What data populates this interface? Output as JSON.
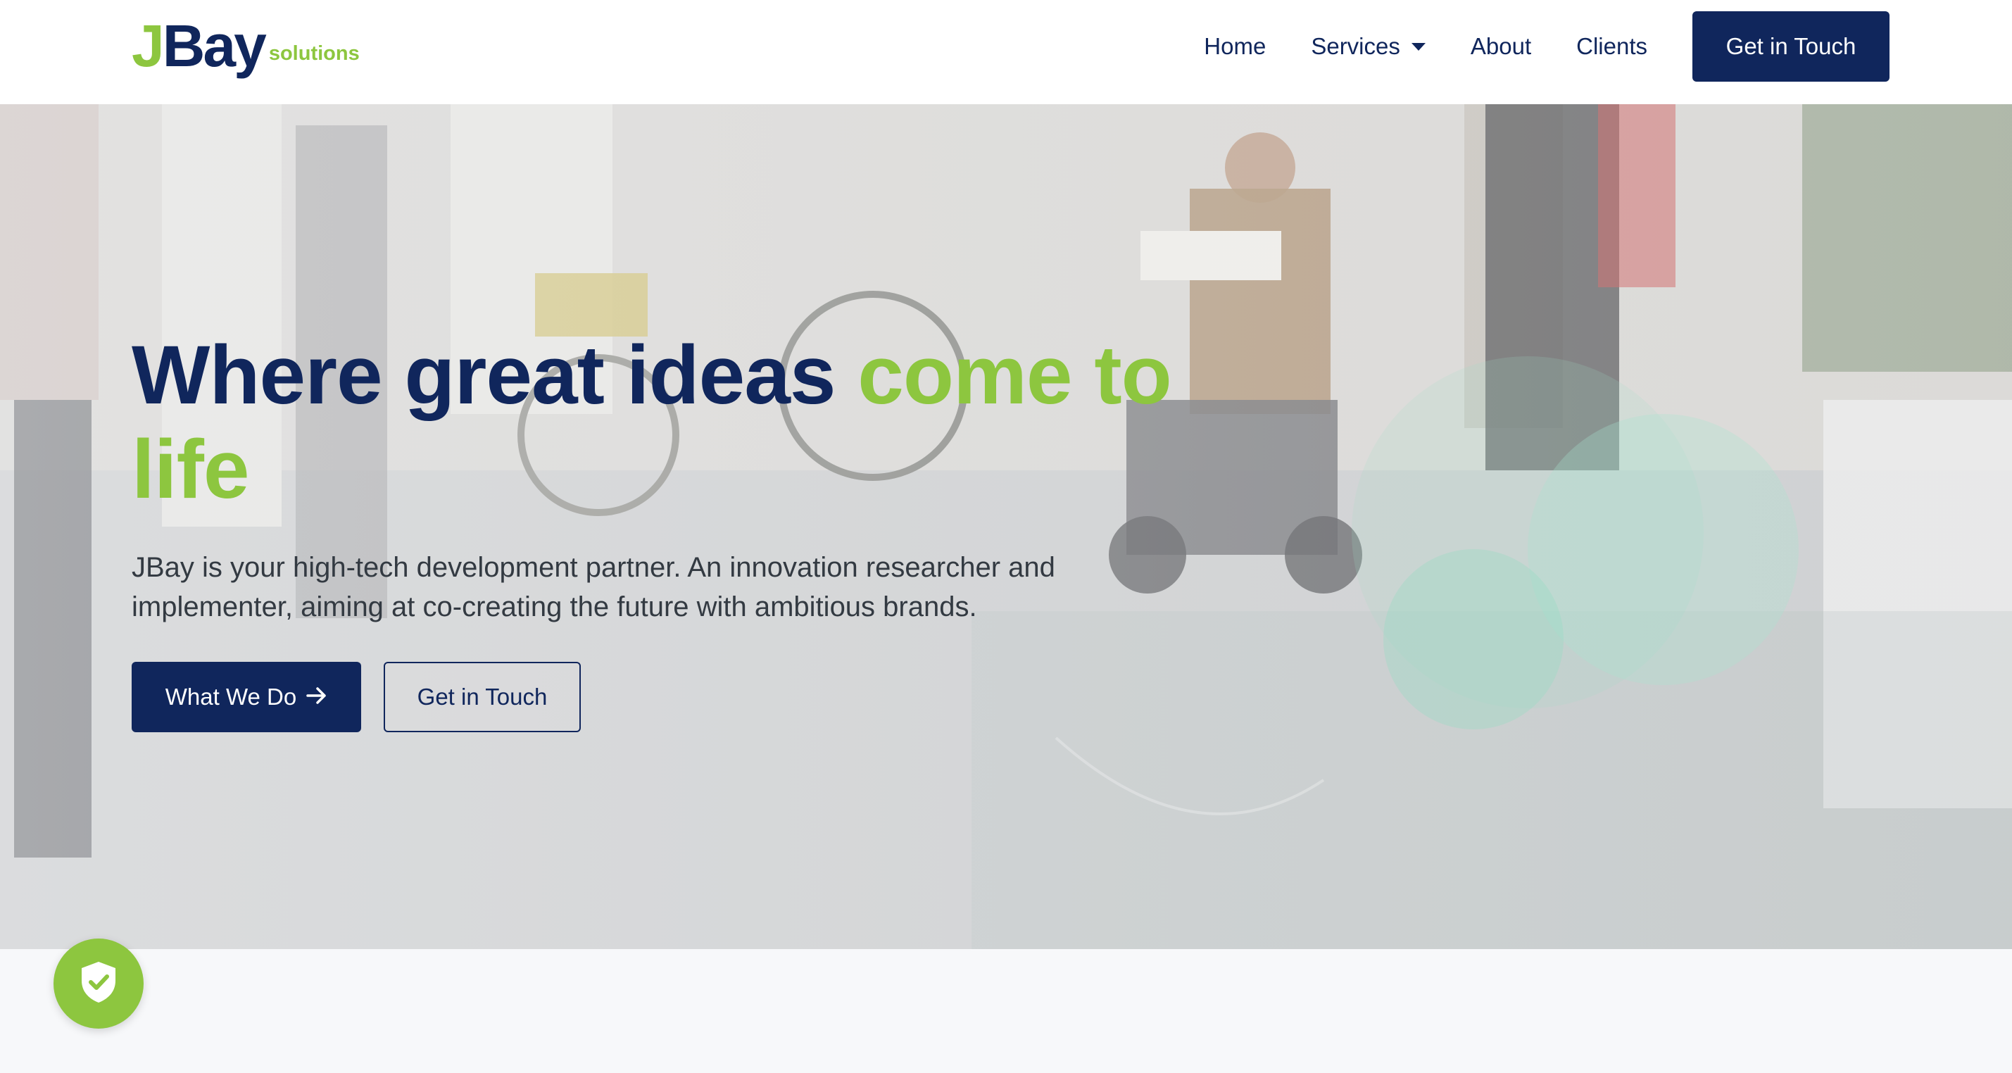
{
  "brand": {
    "logo_j": "J",
    "logo_bay": "Bay",
    "logo_sub": "solutions",
    "primary_color": "#10265c",
    "accent_color": "#8dc63f"
  },
  "nav": {
    "items": [
      {
        "label": "Home"
      },
      {
        "label": "Services",
        "has_dropdown": true
      },
      {
        "label": "About"
      },
      {
        "label": "Clients"
      }
    ],
    "cta_label": "Get in Touch"
  },
  "hero": {
    "title_main": "Where great ideas ",
    "title_accent": "come to life",
    "description": "JBay is your high-tech development partner. An innovation researcher and implementer, aiming at co-creating the future with ambitious brands.",
    "primary_button": "What We Do",
    "primary_button_icon": "arrow-right-icon",
    "secondary_button": "Get in Touch",
    "background_image": "person-in-power-wheelchair-at-expo-hall"
  },
  "security_badge": {
    "icon": "shield-check-icon"
  }
}
